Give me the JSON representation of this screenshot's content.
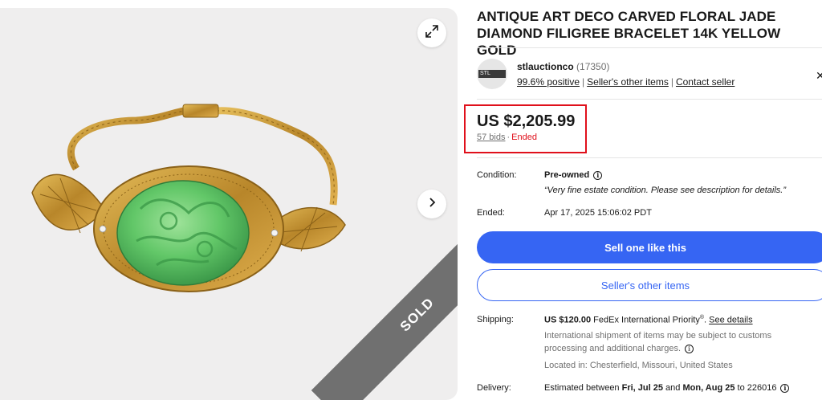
{
  "listing": {
    "title": "ANTIQUE ART DECO CARVED FLORAL JADE DIAMOND FILIGREE BRACELET 14K YELLOW GOLD",
    "sold_badge": "SOLD"
  },
  "seller": {
    "name": "stlauctionco",
    "feedback_count": "(17350)",
    "positive": "99.6% positive",
    "other_items_link": "Seller's other items",
    "contact_link": "Contact seller",
    "logo_text": "STL"
  },
  "price": {
    "amount": "US $2,205.99",
    "bids": "57 bids",
    "separator": "·",
    "status": "Ended"
  },
  "details": {
    "condition_label": "Condition:",
    "condition_value": "Pre-owned",
    "condition_quote": "“Very fine estate condition. Please see description for details.”",
    "ended_label": "Ended:",
    "ended_value": "Apr 17, 2025 15:06:02 PDT"
  },
  "actions": {
    "primary": "Sell one like this",
    "secondary": "Seller's other items"
  },
  "shipping": {
    "label": "Shipping:",
    "cost": "US $120.00",
    "method": "FedEx International Priority",
    "reg": "®",
    "period": ".",
    "see_details": "See details",
    "note": "International shipment of items may be subject to customs processing and additional charges.",
    "location": "Located in: Chesterfield, Missouri, United States"
  },
  "delivery": {
    "label": "Delivery:",
    "prefix": "Estimated between",
    "start": "Fri, Jul 25",
    "and": "and",
    "end": "Mon, Aug 25",
    "to": "to 226016"
  },
  "icons": {
    "expand": "expand-icon",
    "next": "chevron-right-icon",
    "info": "info-icon",
    "close": "close-icon"
  },
  "colors": {
    "accent": "#3665f3",
    "ended": "#e0101b",
    "highlight_box": "#e0101b",
    "gallery_bg": "#efeeee",
    "jade": "#5fc36a",
    "gold": "#c99a2e"
  }
}
